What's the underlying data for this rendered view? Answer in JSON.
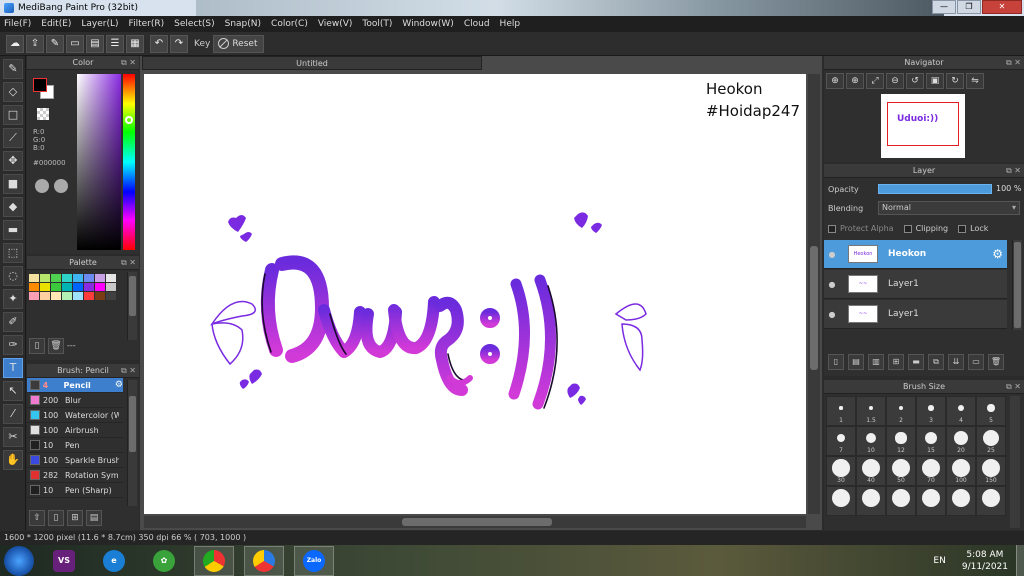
{
  "window": {
    "title": "MediBang Paint Pro (32bit)"
  },
  "menu": [
    "File(F)",
    "Edit(E)",
    "Layer(L)",
    "Filter(R)",
    "Select(S)",
    "Snap(N)",
    "Color(C)",
    "View(V)",
    "Tool(T)",
    "Window(W)",
    "Cloud",
    "Help"
  ],
  "toolbar": {
    "key_label": "Key",
    "reset_label": "Reset"
  },
  "color_panel": {
    "title": "Color",
    "r": "R:0",
    "g": "G:0",
    "b": "B:0",
    "hex": "#000000",
    "accent": "#8a2be2"
  },
  "palette_panel": {
    "title": "Palette",
    "colors": [
      "#f5e2a0",
      "#b7e86b",
      "#50d050",
      "#2fd4c8",
      "#3fb6f2",
      "#6b8bf0",
      "#c8a0e6",
      "#e6e6e6",
      "#ff8c00",
      "#e8e000",
      "#3cc83c",
      "#00b4b4",
      "#0064ff",
      "#8a2be2",
      "#ff00ff",
      "#c8c8c8",
      "#ff9fb6",
      "#ffd0a0",
      "#ffe6b4",
      "#b4f0b4",
      "#a0e0ff",
      "#ff3c3c",
      "#7a3c14",
      "#404040"
    ],
    "swatch_extra": "---"
  },
  "brush_panel": {
    "title": "Brush: Pencil",
    "brushes": [
      {
        "size": "4",
        "name": "Pencil",
        "color": "#3b3b3b",
        "active": true
      },
      {
        "size": "200",
        "name": "Blur",
        "color": "#f07ad0",
        "active": false
      },
      {
        "size": "100",
        "name": "Watercolor (W",
        "color": "#35c6f0",
        "active": false
      },
      {
        "size": "100",
        "name": "Airbrush",
        "color": "#e0e0e0",
        "active": false
      },
      {
        "size": "10",
        "name": "Pen",
        "color": "#202020",
        "active": false
      },
      {
        "size": "100",
        "name": "Sparkle Brush",
        "color": "#3a4ae0",
        "active": false
      },
      {
        "size": "282",
        "name": "Rotation Sym",
        "color": "#e03030",
        "active": false
      },
      {
        "size": "10",
        "name": "Pen (Sharp)",
        "color": "#202020",
        "active": false
      }
    ]
  },
  "document": {
    "tab": "Untitled",
    "watermark_line1": "Heokon",
    "watermark_line2": "#Hoidap247",
    "lettering": "Uduoi:))"
  },
  "navigator": {
    "title": "Navigator"
  },
  "layer_panel": {
    "title": "Layer",
    "opacity_label": "Opacity",
    "opacity_value": "100 %",
    "opacity_fraction": 1.0,
    "blending_label": "Blending",
    "blending_value": "Normal",
    "protect_alpha": "Protect Alpha",
    "clipping": "Clipping",
    "lock": "Lock",
    "layers": [
      {
        "name": "Heokon",
        "active": true
      },
      {
        "name": "Layer1",
        "active": false
      },
      {
        "name": "Layer1",
        "active": false
      }
    ]
  },
  "brush_size_panel": {
    "title": "Brush Size",
    "sizes": [
      "1",
      "1.5",
      "2",
      "3",
      "4",
      "5",
      "7",
      "10",
      "12",
      "15",
      "20",
      "25",
      "30",
      "40",
      "50",
      "70",
      "100",
      "150",
      "",
      "",
      "",
      "",
      "",
      ""
    ]
  },
  "status": "1600 * 1200 pixel  (11.6 * 8.7cm)  350 dpi  66 %  ( 703, 1000 )",
  "taskbar": {
    "language": "EN",
    "time": "5:08 AM",
    "date": "9/11/2021",
    "apps": [
      "visual-studio",
      "internet-explorer",
      "vpn-app",
      "chrome",
      "medibang",
      "zalo"
    ],
    "zalo_label": "Zalo"
  }
}
